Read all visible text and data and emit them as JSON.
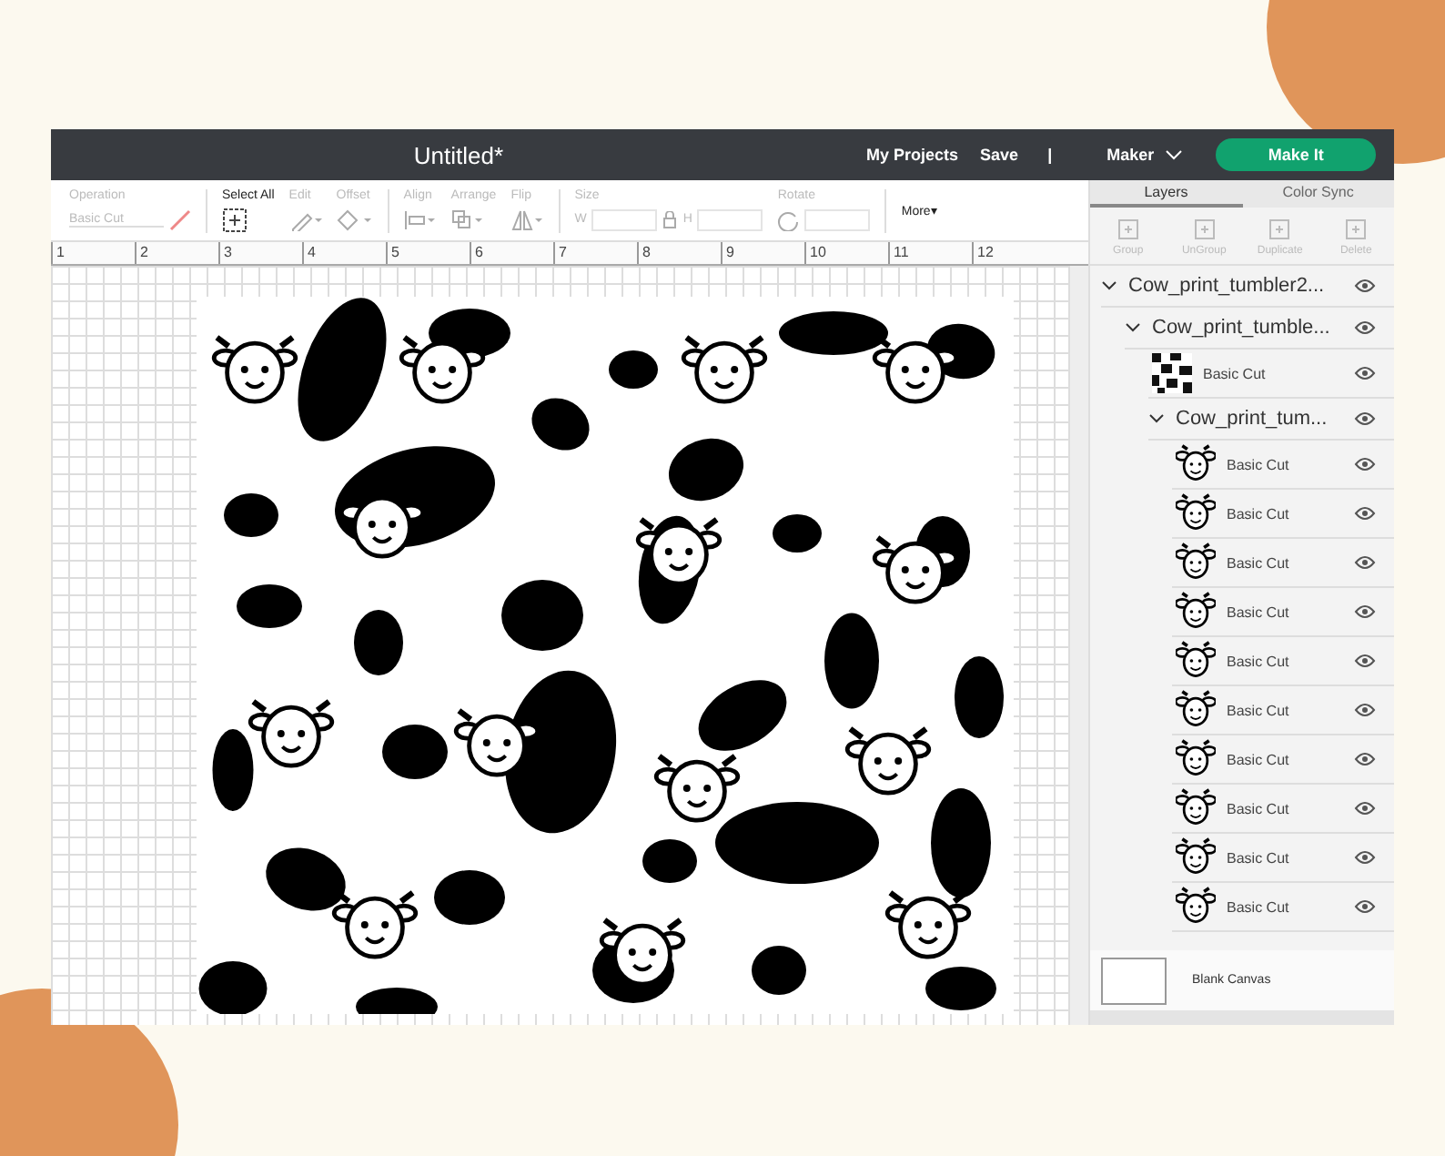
{
  "window": {
    "title": "Untitled*"
  },
  "header": {
    "links": [
      "My Projects",
      "Save"
    ],
    "separator": "|",
    "machine": "Maker",
    "primary_button": "Make It"
  },
  "toolbar": {
    "groups": [
      {
        "label": "Operation",
        "kind": "dropdown",
        "value": "Basic Cut",
        "disabled": true
      },
      {
        "label": "Select All",
        "kind": "select",
        "disabled": false
      },
      {
        "label": "Edit",
        "kind": "edit",
        "disabled": true
      },
      {
        "label": "Offset",
        "kind": "offset",
        "disabled": true
      },
      {
        "label": "Align",
        "kind": "align",
        "disabled": true
      },
      {
        "label": "Arrange",
        "kind": "arrange",
        "disabled": true
      },
      {
        "label": "Flip",
        "kind": "flip",
        "disabled": true
      },
      {
        "label": "Size",
        "kind": "size",
        "fields": [
          "W",
          "H"
        ],
        "disabled": true
      },
      {
        "label": "Rotate",
        "kind": "rotate",
        "disabled": true
      }
    ],
    "more": "More▾"
  },
  "ruler": [
    "1",
    "2",
    "3",
    "4",
    "5",
    "6",
    "7",
    "8",
    "9",
    "10",
    "11",
    "12"
  ],
  "layers_panel": {
    "tabs": [
      {
        "label": "Layers",
        "selected": true
      },
      {
        "label": "Color Sync",
        "selected": false
      }
    ],
    "actions": [
      {
        "label": "Group",
        "disabled": true
      },
      {
        "label": "UnGroup",
        "disabled": true
      },
      {
        "label": "Duplicate",
        "disabled": true
      },
      {
        "label": "Delete",
        "disabled": true
      }
    ],
    "layers": [
      {
        "kind": "group",
        "name": "Cow_print_tumbler2...",
        "expanded": true,
        "children": [
          {
            "kind": "group",
            "name": "Cow_print_tumble...",
            "expanded": true,
            "children": [
              {
                "kind": "pattern",
                "name": "Basic Cut"
              },
              {
                "kind": "group",
                "name": "Cow_print_tum...",
                "expanded": true,
                "children": [
                  {
                    "kind": "cow",
                    "name": "Basic Cut"
                  },
                  {
                    "kind": "cow",
                    "name": "Basic Cut"
                  },
                  {
                    "kind": "cow",
                    "name": "Basic Cut"
                  },
                  {
                    "kind": "cow",
                    "name": "Basic Cut"
                  },
                  {
                    "kind": "cow",
                    "name": "Basic Cut"
                  },
                  {
                    "kind": "cow",
                    "name": "Basic Cut"
                  },
                  {
                    "kind": "cow",
                    "name": "Basic Cut"
                  },
                  {
                    "kind": "cow",
                    "name": "Basic Cut"
                  },
                  {
                    "kind": "cow",
                    "name": "Basic Cut"
                  },
                  {
                    "kind": "cow",
                    "name": "Basic Cut"
                  }
                ]
              }
            ]
          }
        ]
      }
    ],
    "blank_canvas": "Blank Canvas"
  }
}
